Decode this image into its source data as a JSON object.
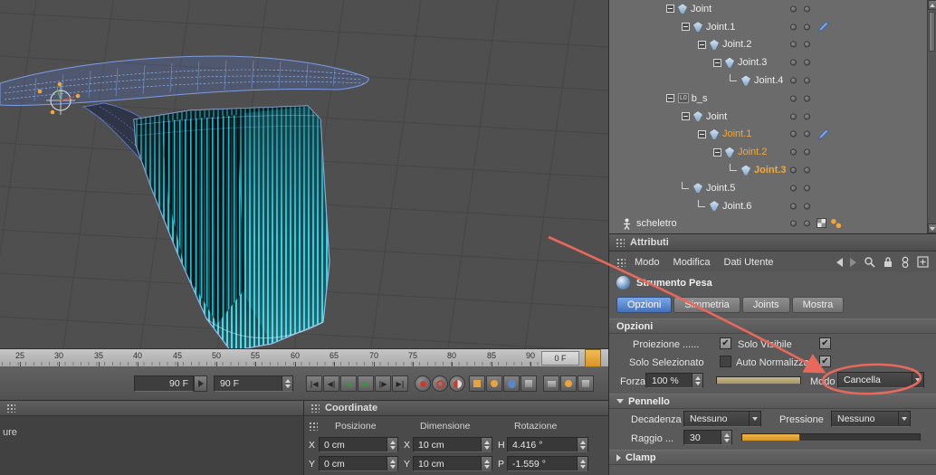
{
  "colors": {
    "accent_orange": "#f0a83a",
    "active_tab_blue": "#4d7fc8",
    "annotation_red": "#e8685c",
    "mesh_cyan": "#3cd8e8"
  },
  "icons": {
    "check": "✔"
  },
  "viewport": {
    "ruler_ticks": [
      "25",
      "30",
      "35",
      "40",
      "45",
      "50",
      "55",
      "60",
      "65",
      "70",
      "75",
      "80",
      "85",
      "90"
    ],
    "ruler_end_label": "0 F"
  },
  "timeline": {
    "frame_display": "90 F",
    "frame_field": "90 F",
    "transport": [
      {
        "name": "go-to-start",
        "glyph": "|◀"
      },
      {
        "name": "previous-key",
        "glyph": "◀|"
      },
      {
        "name": "play-backward",
        "glyph": "◀"
      },
      {
        "name": "play-forward",
        "glyph": "▶"
      },
      {
        "name": "next-key",
        "glyph": "|▶"
      },
      {
        "name": "go-to-end",
        "glyph": "▶|"
      }
    ]
  },
  "left_panel": {
    "partial_label": "ure"
  },
  "coordinate": {
    "title": "Coordinate",
    "columns": [
      "Posizione",
      "Dimensione",
      "Rotazione"
    ],
    "rows": [
      {
        "pos_axis": "X",
        "pos": "0 cm",
        "dim_axis": "X",
        "dim": "10 cm",
        "rot_axis": "H",
        "rot": "4.416 °"
      },
      {
        "pos_axis": "Y",
        "pos": "0 cm",
        "dim_axis": "Y",
        "dim": "10 cm",
        "rot_axis": "P",
        "rot": "-1.559 °"
      }
    ]
  },
  "object_manager": {
    "items": [
      {
        "label": "Joint",
        "selected": false
      },
      {
        "label": "Joint.1",
        "selected": false
      },
      {
        "label": "Joint.2",
        "selected": false
      },
      {
        "label": "Joint.3",
        "selected": false
      },
      {
        "label": "Joint.4",
        "selected": false
      },
      {
        "label": "b_s",
        "selected": false,
        "badge": "L0"
      },
      {
        "label": "Joint",
        "selected": false
      },
      {
        "label": "Joint.1",
        "selected": true
      },
      {
        "label": "Joint.2",
        "selected": true
      },
      {
        "label": "Joint.3",
        "selected": true
      },
      {
        "label": "Joint.5",
        "selected": false
      },
      {
        "label": "Joint.6",
        "selected": false
      },
      {
        "label": "scheletro",
        "selected": false
      }
    ]
  },
  "attributes": {
    "title": "Attributi",
    "menu": [
      "Modo",
      "Modifica",
      "Dati Utente"
    ],
    "tool_label": "Strumento Pesa",
    "tabs": [
      "Opzioni",
      "Simmetria",
      "Joints",
      "Mostra"
    ],
    "active_tab": "Opzioni",
    "sections": {
      "opzioni": "Opzioni",
      "pennello": "Pennello",
      "clamp": "Clamp"
    },
    "fields": {
      "proiezione_label": "Proiezione ......",
      "solo_visibile_label": "Solo Visibile",
      "solo_selezionato_label": "Solo Selezionato",
      "auto_normalizza_label": "Auto Normalizza",
      "forza_label": "Forza",
      "forza_value": "100 %",
      "modo_label": "Modo",
      "modo_value": "Cancella",
      "decadenza_label": "Decadenza",
      "decadenza_value": "Nessuno",
      "pressione_label": "Pressione",
      "pressione_value": "Nessuno",
      "raggio_label": "Raggio ...",
      "raggio_value": "30"
    },
    "checkboxes": {
      "proiezione": true,
      "solo_visibile": true,
      "solo_selezionato": false,
      "auto_normalizza": true
    }
  }
}
